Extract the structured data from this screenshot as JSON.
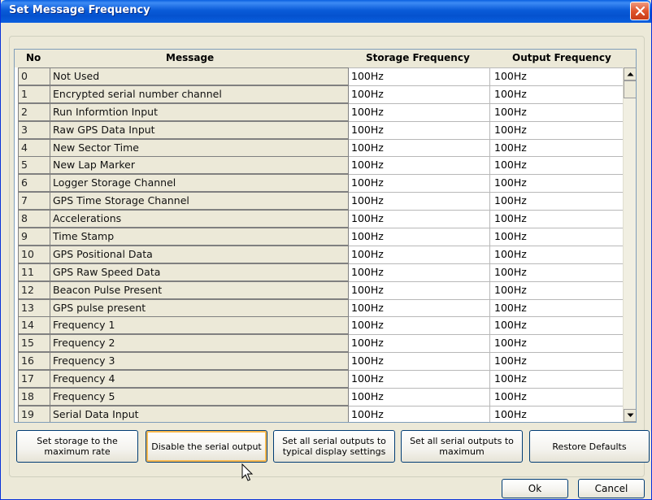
{
  "window": {
    "title": "Set Message Frequency"
  },
  "table": {
    "headers": {
      "no": "No",
      "message": "Message",
      "storage": "Storage Frequency",
      "output": "Output Frequency"
    },
    "rows": [
      {
        "no": "0",
        "message": "Not Used",
        "storage": "100Hz",
        "output": "100Hz"
      },
      {
        "no": "1",
        "message": "Encrypted serial number channel",
        "storage": "100Hz",
        "output": "100Hz"
      },
      {
        "no": "2",
        "message": "Run Informtion Input",
        "storage": "100Hz",
        "output": "100Hz"
      },
      {
        "no": "3",
        "message": "Raw GPS Data Input",
        "storage": "100Hz",
        "output": "100Hz"
      },
      {
        "no": "4",
        "message": "New Sector Time",
        "storage": "100Hz",
        "output": "100Hz"
      },
      {
        "no": "5",
        "message": "New Lap Marker",
        "storage": "100Hz",
        "output": "100Hz"
      },
      {
        "no": "6",
        "message": "Logger Storage Channel",
        "storage": "100Hz",
        "output": "100Hz"
      },
      {
        "no": "7",
        "message": "GPS Time Storage Channel",
        "storage": "100Hz",
        "output": "100Hz"
      },
      {
        "no": "8",
        "message": "Accelerations",
        "storage": "100Hz",
        "output": "100Hz"
      },
      {
        "no": "9",
        "message": "Time Stamp",
        "storage": "100Hz",
        "output": "100Hz"
      },
      {
        "no": "10",
        "message": "GPS Positional Data",
        "storage": "100Hz",
        "output": "100Hz"
      },
      {
        "no": "11",
        "message": "GPS Raw Speed Data",
        "storage": "100Hz",
        "output": "100Hz"
      },
      {
        "no": "12",
        "message": "Beacon Pulse Present",
        "storage": "100Hz",
        "output": "100Hz"
      },
      {
        "no": "13",
        "message": "GPS pulse present",
        "storage": "100Hz",
        "output": "100Hz"
      },
      {
        "no": "14",
        "message": "Frequency 1",
        "storage": "100Hz",
        "output": "100Hz"
      },
      {
        "no": "15",
        "message": "Frequency 2",
        "storage": "100Hz",
        "output": "100Hz"
      },
      {
        "no": "16",
        "message": "Frequency 3",
        "storage": "100Hz",
        "output": "100Hz"
      },
      {
        "no": "17",
        "message": "Frequency 4",
        "storage": "100Hz",
        "output": "100Hz"
      },
      {
        "no": "18",
        "message": "Frequency 5",
        "storage": "100Hz",
        "output": "100Hz"
      },
      {
        "no": "19",
        "message": "Serial Data Input",
        "storage": "100Hz",
        "output": "100Hz"
      }
    ]
  },
  "buttons": {
    "set_storage_max": "Set storage to the maximum rate",
    "disable_serial": "Disable the serial output",
    "set_serial_typical": "Set all serial outputs to typical display settings",
    "set_serial_max": "Set all serial outputs to maximum",
    "restore_defaults": "Restore Defaults",
    "ok": "Ok",
    "cancel": "Cancel"
  },
  "icons": {
    "close": "close-icon",
    "scroll_up": "arrow-up-icon",
    "scroll_down": "arrow-down-icon",
    "cursor": "mouse-pointer-icon"
  },
  "colors": {
    "titlebar": "#0a5bd8",
    "dialog_bg": "#ece9d8",
    "focus_ring": "#f9b94f",
    "close_button": "#e0552c"
  }
}
